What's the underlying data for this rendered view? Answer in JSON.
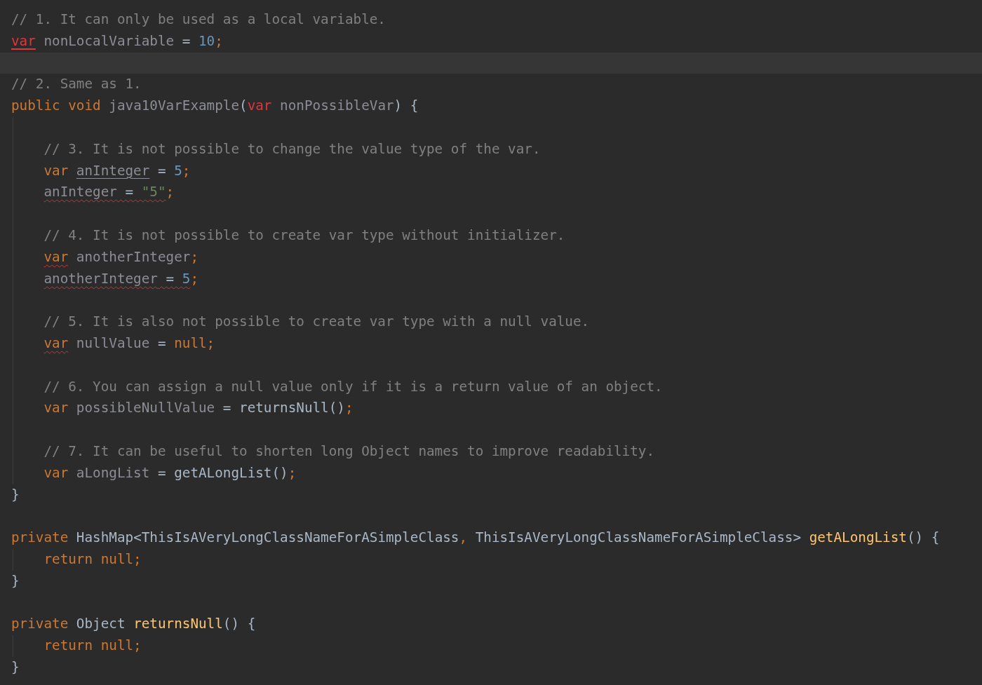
{
  "editor": {
    "lines": [
      {
        "kind": "code",
        "tokens": [
          {
            "kind": "comment",
            "text": "// 1. It can only be used as a local variable."
          }
        ]
      },
      {
        "kind": "code",
        "tokens": [
          {
            "kind": "error",
            "text": "var",
            "error_underline": true
          },
          {
            "kind": "unused",
            "text": " nonLocalVariable"
          },
          {
            "kind": "plain",
            "text": " = "
          },
          {
            "kind": "number",
            "text": "10"
          },
          {
            "kind": "punct",
            "text": ";"
          }
        ]
      },
      {
        "kind": "current"
      },
      {
        "kind": "code",
        "tokens": [
          {
            "kind": "comment",
            "text": "// 2. Same as 1."
          }
        ]
      },
      {
        "kind": "code",
        "tokens": [
          {
            "kind": "keyword",
            "text": "public void"
          },
          {
            "kind": "unused",
            "text": " java10VarExample"
          },
          {
            "kind": "plain",
            "text": "("
          },
          {
            "kind": "error",
            "text": "var"
          },
          {
            "kind": "unused",
            "text": " nonPossibleVar"
          },
          {
            "kind": "plain",
            "text": ") {"
          }
        ],
        "children": [
          {
            "kind": "blank"
          },
          {
            "kind": "code",
            "tokens": [
              {
                "kind": "comment",
                "text": "// 3. It is not possible to change the value type of the var."
              }
            ]
          },
          {
            "kind": "code",
            "tokens": [
              {
                "kind": "keyword",
                "text": "var "
              },
              {
                "kind": "unused",
                "text": "anInteger",
                "usage_underline": true
              },
              {
                "kind": "plain",
                "text": " = "
              },
              {
                "kind": "number",
                "text": "5"
              },
              {
                "kind": "punct",
                "text": ";"
              }
            ]
          },
          {
            "kind": "code",
            "tokens": [
              {
                "kind": "unused",
                "text": "anInteger",
                "squiggle": true
              },
              {
                "kind": "plain",
                "text": " = ",
                "squiggle": true
              },
              {
                "kind": "string",
                "text": "\"5\"",
                "squiggle": true
              },
              {
                "kind": "punct",
                "text": ";"
              }
            ]
          },
          {
            "kind": "blank"
          },
          {
            "kind": "code",
            "tokens": [
              {
                "kind": "comment",
                "text": "// 4. It is not possible to create var type without initializer."
              }
            ]
          },
          {
            "kind": "code",
            "tokens": [
              {
                "kind": "keyword",
                "text": "var",
                "squiggle": true
              },
              {
                "kind": "unused",
                "text": " anotherInteger"
              },
              {
                "kind": "punct",
                "text": ";"
              }
            ]
          },
          {
            "kind": "code",
            "tokens": [
              {
                "kind": "unused",
                "text": "anotherInteger",
                "squiggle": true
              },
              {
                "kind": "plain",
                "text": " = ",
                "squiggle": true
              },
              {
                "kind": "number",
                "text": "5",
                "squiggle": true
              },
              {
                "kind": "punct",
                "text": ";"
              }
            ]
          },
          {
            "kind": "blank"
          },
          {
            "kind": "code",
            "tokens": [
              {
                "kind": "comment",
                "text": "// 5. It is also not possible to create var type with a null value."
              }
            ]
          },
          {
            "kind": "code",
            "tokens": [
              {
                "kind": "keyword",
                "text": "var",
                "squiggle": true
              },
              {
                "kind": "unused",
                "text": " nullValue"
              },
              {
                "kind": "plain",
                "text": " = "
              },
              {
                "kind": "keyword",
                "text": "null;"
              }
            ]
          },
          {
            "kind": "blank"
          },
          {
            "kind": "code",
            "tokens": [
              {
                "kind": "comment",
                "text": "// 6. You can assign a null value only if it is a return value of an object."
              }
            ]
          },
          {
            "kind": "code",
            "tokens": [
              {
                "kind": "keyword",
                "text": "var"
              },
              {
                "kind": "unused",
                "text": " possibleNullValue"
              },
              {
                "kind": "plain",
                "text": " = returnsNull()"
              },
              {
                "kind": "punct",
                "text": ";"
              }
            ]
          },
          {
            "kind": "blank"
          },
          {
            "kind": "code",
            "tokens": [
              {
                "kind": "comment",
                "text": "// 7. It can be useful to shorten long Object names to improve readability."
              }
            ]
          },
          {
            "kind": "code",
            "tokens": [
              {
                "kind": "keyword",
                "text": "var"
              },
              {
                "kind": "unused",
                "text": " aLongList"
              },
              {
                "kind": "plain",
                "text": " = getALongList()"
              },
              {
                "kind": "punct",
                "text": ";"
              }
            ]
          }
        ]
      },
      {
        "kind": "code",
        "tokens": [
          {
            "kind": "plain",
            "text": "}"
          }
        ]
      },
      {
        "kind": "blank"
      },
      {
        "kind": "code",
        "tokens": [
          {
            "kind": "keyword",
            "text": "private"
          },
          {
            "kind": "plain",
            "text": " HashMap<ThisIsAVeryLongClassNameForASimpleClass"
          },
          {
            "kind": "punct",
            "text": ", "
          },
          {
            "kind": "plain",
            "text": "ThisIsAVeryLongClassNameForASimpleClass> "
          },
          {
            "kind": "method",
            "text": "getALongList"
          },
          {
            "kind": "plain",
            "text": "() {"
          }
        ],
        "children": [
          {
            "kind": "code",
            "tokens": [
              {
                "kind": "keyword",
                "text": "return null;"
              }
            ]
          }
        ]
      },
      {
        "kind": "code",
        "tokens": [
          {
            "kind": "plain",
            "text": "}"
          }
        ]
      },
      {
        "kind": "blank"
      },
      {
        "kind": "code",
        "tokens": [
          {
            "kind": "keyword",
            "text": "private"
          },
          {
            "kind": "plain",
            "text": " Object "
          },
          {
            "kind": "method",
            "text": "returnsNull"
          },
          {
            "kind": "plain",
            "text": "() {"
          }
        ],
        "children": [
          {
            "kind": "code",
            "tokens": [
              {
                "kind": "keyword",
                "text": "return null;"
              }
            ]
          }
        ]
      },
      {
        "kind": "code",
        "tokens": [
          {
            "kind": "plain",
            "text": "}"
          }
        ]
      }
    ]
  }
}
